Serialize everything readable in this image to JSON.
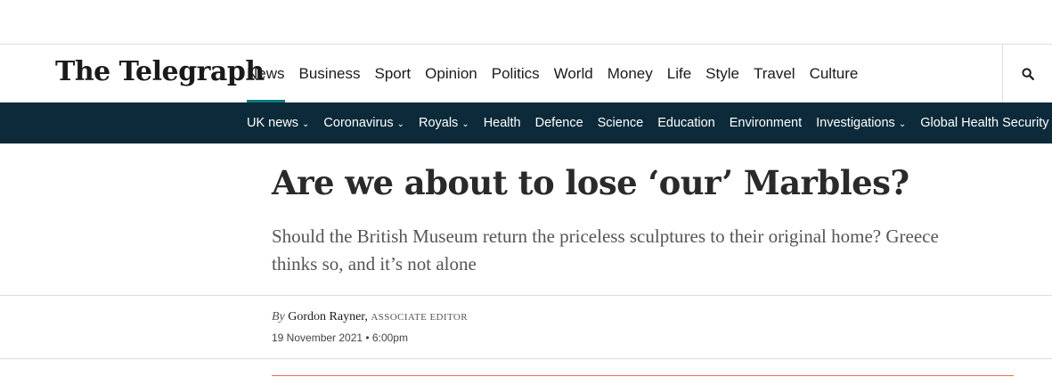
{
  "masthead": {
    "logo": "The Telegraph",
    "nav": [
      {
        "label": "News",
        "active": true
      },
      {
        "label": "Business"
      },
      {
        "label": "Sport"
      },
      {
        "label": "Opinion"
      },
      {
        "label": "Politics"
      },
      {
        "label": "World"
      },
      {
        "label": "Money"
      },
      {
        "label": "Life"
      },
      {
        "label": "Style"
      },
      {
        "label": "Travel"
      },
      {
        "label": "Culture"
      }
    ],
    "search_icon": "search-icon",
    "accent_color": "#0e7a7a"
  },
  "subnav": {
    "background": "#0c2a3a",
    "items": [
      {
        "label": "UK news",
        "dropdown": true
      },
      {
        "label": "Coronavirus",
        "dropdown": true
      },
      {
        "label": "Royals",
        "dropdown": true
      },
      {
        "label": "Health"
      },
      {
        "label": "Defence"
      },
      {
        "label": "Science"
      },
      {
        "label": "Education"
      },
      {
        "label": "Environment"
      },
      {
        "label": "Investigations",
        "dropdown": true
      },
      {
        "label": "Global Health Security",
        "dropdown": true
      }
    ]
  },
  "article": {
    "headline": "Are we about to lose ‘our’ Marbles?",
    "standfirst": "Should the British Museum return the priceless sculptures to their original home? Greece thinks so, and it’s not alone",
    "byline": {
      "prefix": "By",
      "author": "Gordon Rayner,",
      "role": "ASSOCIATE EDITOR"
    },
    "date": "19 November 2021 • 6:00pm",
    "accent_rule_color": "#e0725a"
  }
}
